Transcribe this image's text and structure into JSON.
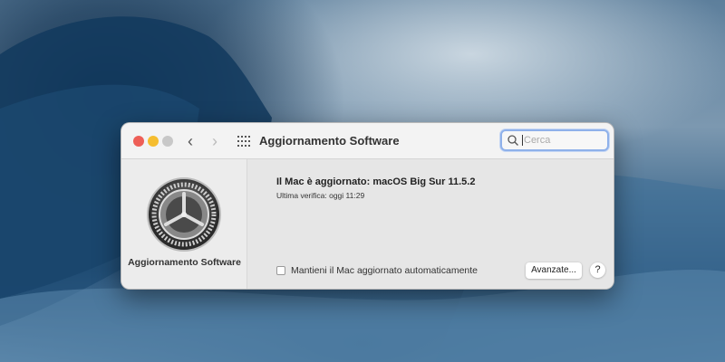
{
  "window": {
    "title": "Aggiornamento Software",
    "search": {
      "placeholder": "Cerca",
      "value": ""
    },
    "nav": {
      "back_icon": "‹",
      "forward_icon": "›"
    },
    "traffic_lights": {
      "close": "#ee5f57",
      "minimize": "#f5bd2f",
      "zoom": "#c8c8c8"
    }
  },
  "sidebar": {
    "label": "Aggiornamento Software"
  },
  "main": {
    "status": "Il Mac è aggiornato: macOS Big Sur 11.5.2",
    "last_check": "Ultima verifica: oggi 11:29",
    "auto_update_label": "Mantieni il Mac aggiornato automaticamente",
    "auto_update_checked": false,
    "advanced_button": "Avanzate...",
    "help_button": "?"
  }
}
